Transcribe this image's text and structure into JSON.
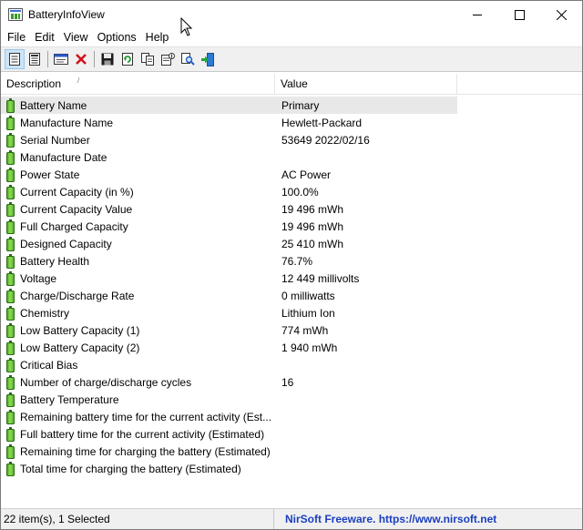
{
  "window": {
    "title": "BatteryInfoView"
  },
  "window_controls": {
    "minimize": "—",
    "maximize": "☐",
    "close": "✕"
  },
  "menu": [
    "File",
    "Edit",
    "View",
    "Options",
    "Help"
  ],
  "columns": {
    "description": "Description",
    "value": "Value"
  },
  "rows": [
    {
      "description": "Battery Name",
      "value": "Primary"
    },
    {
      "description": "Manufacture Name",
      "value": "Hewlett-Packard"
    },
    {
      "description": "Serial Number",
      "value": "53649 2022/02/16"
    },
    {
      "description": "Manufacture Date",
      "value": ""
    },
    {
      "description": "Power State",
      "value": "AC Power"
    },
    {
      "description": "Current Capacity (in %)",
      "value": "100.0%"
    },
    {
      "description": "Current Capacity Value",
      "value": "19 496 mWh"
    },
    {
      "description": "Full Charged Capacity",
      "value": "19 496 mWh"
    },
    {
      "description": "Designed Capacity",
      "value": "25 410 mWh"
    },
    {
      "description": "Battery Health",
      "value": "76.7%"
    },
    {
      "description": "Voltage",
      "value": "12 449 millivolts"
    },
    {
      "description": "Charge/Discharge Rate",
      "value": "0 milliwatts"
    },
    {
      "description": "Chemistry",
      "value": "Lithium Ion"
    },
    {
      "description": "Low Battery Capacity (1)",
      "value": "774 mWh"
    },
    {
      "description": "Low Battery Capacity (2)",
      "value": "1 940 mWh"
    },
    {
      "description": "Critical Bias",
      "value": ""
    },
    {
      "description": "Number of charge/discharge cycles",
      "value": "16"
    },
    {
      "description": "Battery Temperature",
      "value": ""
    },
    {
      "description": "Remaining battery time for the current activity (Est...",
      "value": ""
    },
    {
      "description": "Full battery time for the current activity (Estimated)",
      "value": ""
    },
    {
      "description": "Remaining time for charging the battery (Estimated)",
      "value": ""
    },
    {
      "description": "Total  time for charging the battery (Estimated)",
      "value": ""
    }
  ],
  "selected_row": 0,
  "status": {
    "count": "22 item(s), 1 Selected",
    "link": "NirSoft Freeware. https://www.nirsoft.net"
  }
}
